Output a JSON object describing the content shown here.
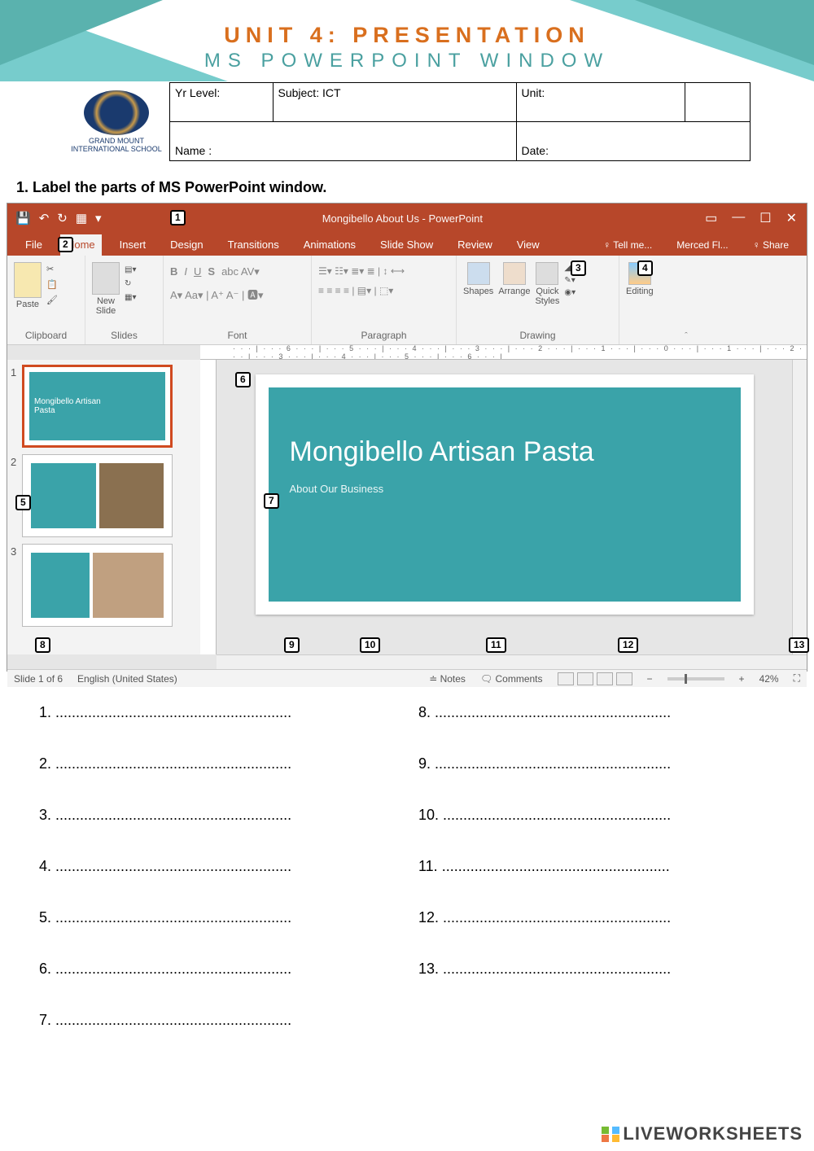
{
  "header": {
    "title": "UNIT 4: PRESENTATION",
    "subtitle": "MS POWERPOINT WINDOW"
  },
  "school_logo_text": "GRAND MOUNT INTERNATIONAL SCHOOL",
  "info": {
    "yr": "Yr Level:",
    "subject": "Subject:  ICT",
    "unit": "Unit:",
    "name": "Name :",
    "date": "Date:"
  },
  "question": "1. Label the parts of MS PowerPoint window.",
  "pp": {
    "title": "Mongibello About Us - PowerPoint",
    "menu": {
      "file": "File",
      "home": "Home",
      "insert": "Insert",
      "design": "Design",
      "transitions": "Transitions",
      "animations": "Animations",
      "slideshow": "Slide Show",
      "review": "Review",
      "view": "View",
      "tell": "♀ Tell me...",
      "acct": "Merced Fl...",
      "share": "♀ Share"
    },
    "ribbon": {
      "clipboard": "Clipboard",
      "paste": "Paste",
      "slides": "Slides",
      "newslide": "New\nSlide",
      "font": "Font",
      "paragraph": "Paragraph",
      "drawing": "Drawing",
      "shapes": "Shapes",
      "arrange": "Arrange",
      "quick": "Quick\nStyles",
      "editing": "Editing"
    },
    "ruler": "· · · | · · · 6 · · · | · · · 5 · · · | · · · 4 · · · | · · · 3 · · · | · · · 2 · · · | · · · 1 · · · | · · · 0 · · · | · · · 1 · · · | · · · 2 · · · | · · · 3 · · · | · · · 4 · · · | · · · 5 · · · | · · · 6 · · · |",
    "slide_title": "Mongibello Artisan Pasta",
    "slide_sub": "About Our Business",
    "thumb1_text": "Mongibello Artisan\nPasta",
    "status": {
      "slide": "Slide 1 of 6",
      "lang": "English (United States)",
      "notes": "≐ Notes",
      "comments": "🗨 Comments",
      "zoom": "42%"
    }
  },
  "labels": {
    "1": "1",
    "2": "2",
    "3": "3",
    "4": "4",
    "5": "5",
    "6": "6",
    "7": "7",
    "8": "8",
    "9": "9",
    "10": "10",
    "11": "11",
    "12": "12",
    "13": "13"
  },
  "answers_left": [
    "1. ..........................................................",
    "2. ..........................................................",
    "3. ..........................................................",
    "4. ..........................................................",
    "5. ..........................................................",
    "6. ..........................................................",
    "7. .........................................................."
  ],
  "answers_right": [
    "8. ..........................................................",
    "9. ..........................................................",
    "10. ........................................................",
    "11. ........................................................",
    "12. ........................................................",
    "13. ........................................................"
  ],
  "watermark": "LIVEWORKSHEETS"
}
